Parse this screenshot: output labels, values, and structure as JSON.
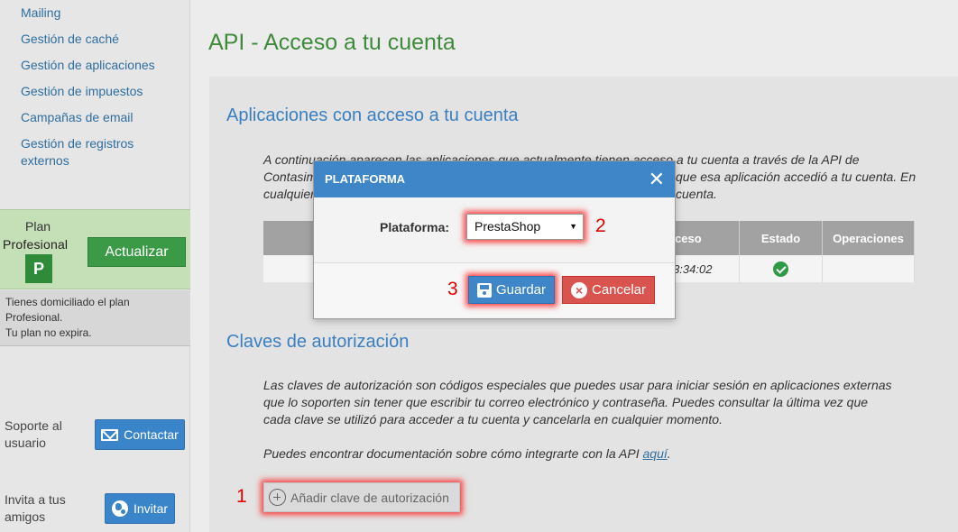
{
  "sidebar": {
    "menu": [
      {
        "label": "Mailing"
      },
      {
        "label": "Gestión de caché"
      },
      {
        "label": "Gestión de aplicaciones"
      },
      {
        "label": "Gestión de impuestos"
      },
      {
        "label": "Campañas de email"
      },
      {
        "label": "Gestión de registros externos"
      }
    ],
    "plan": {
      "word": "Plan",
      "name": "Profesional",
      "badge": "P",
      "upgrade_label": "Actualizar",
      "info_line1": "Tienes domiciliado el plan",
      "info_line2": "Profesional.",
      "info_line3": "Tu plan no expira."
    },
    "support": {
      "label_line1": "Soporte al",
      "label_line2": "usuario",
      "button": "Contactar"
    },
    "invite": {
      "label_line1": "Invita a tus",
      "label_line2": "amigos",
      "button": "Invitar"
    }
  },
  "main": {
    "title": "API - Acceso a tu cuenta",
    "apps_section": {
      "title": "Aplicaciones con acceso a tu cuenta",
      "text_line1": "A continuación aparecen las aplicaciones que actualmente tienen acceso a tu cuenta a través de la API de",
      "text_line2": "Contasimple.",
      "text_line2_tail": "que esa aplicación accedió a tu cuenta. En",
      "text_line3": "cualquier",
      "text_line3_tail": "cuenta.",
      "table": {
        "headers": [
          "",
          "ceso",
          "Estado",
          "Operaciones"
        ],
        "rows": [
          {
            "access": "3:34:02",
            "status_icon": "check-circle-icon"
          }
        ]
      }
    },
    "keys_section": {
      "title": "Claves de autorización",
      "text_line1": "Las claves de autorización son códigos especiales que puedes usar para iniciar sesión en aplicaciones externas",
      "text_line2": "que lo soporten sin tener que escribir tu correo electrónico y contraseña. Puedes consultar la última vez que",
      "text_line3": "cada clave se utilizó para acceder a tu cuenta y cancelarla en cualquier momento.",
      "docs_text": "Puedes encontrar documentación sobre cómo integrarte con la API ",
      "docs_link": "aquí",
      "docs_end": ".",
      "add_button": "Añadir clave de autorización"
    },
    "markers": [
      "1",
      "2",
      "3"
    ]
  },
  "modal": {
    "title": "PLATAFORMA",
    "close": "✕",
    "field_label": "Plataforma:",
    "selected": "PrestaShop",
    "save_label": "Guardar",
    "cancel_label": "Cancelar"
  },
  "colors": {
    "accent_blue": "#3f86c8",
    "title_green": "#3e8a3a",
    "danger_red": "#d9534f",
    "highlight_red": "#e30000"
  }
}
